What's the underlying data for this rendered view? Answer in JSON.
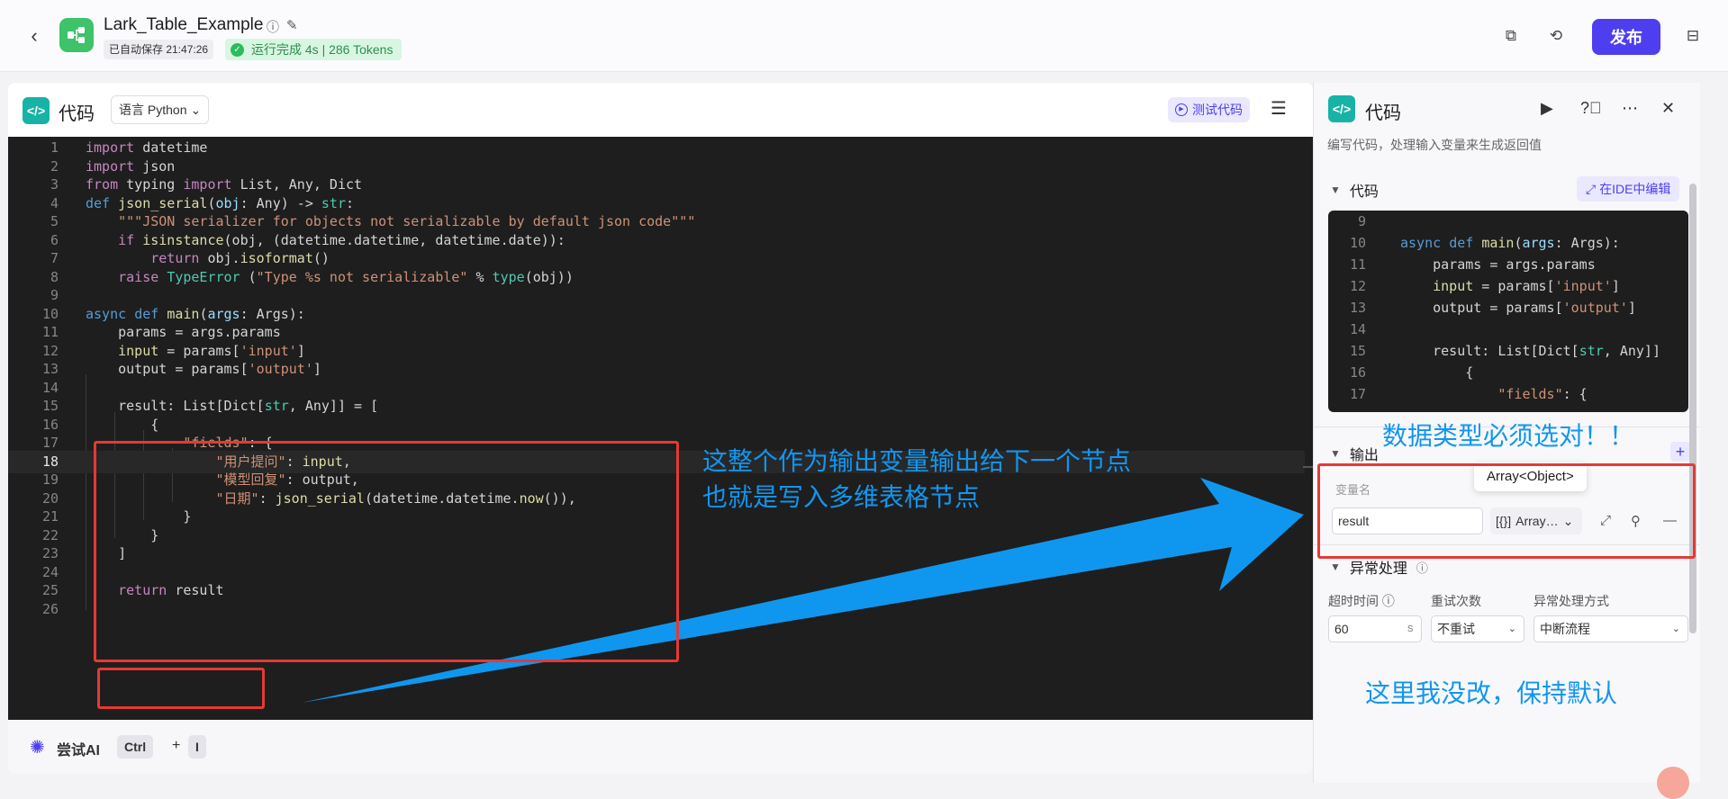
{
  "topbar": {
    "app_title": "Lark_Table_Example",
    "autosave": "已自动保存 21:47:26",
    "run_status": "运行完成 4s | 286 Tokens",
    "publish_label": "发布"
  },
  "editor": {
    "title": "代码",
    "language_select": "语言 Python",
    "test_button": "测试代码",
    "code_lines": [
      "import datetime",
      "import json",
      "from typing import List, Any, Dict",
      "def json_serial(obj: Any) -> str:",
      "    \"\"\"JSON serializer for objects not serializable by default json code\"\"\"",
      "    if isinstance(obj, (datetime.datetime, datetime.date)):",
      "        return obj.isoformat()",
      "    raise TypeError (\"Type %s not serializable\" % type(obj))",
      "",
      "async def main(args: Args):",
      "    params = args.params",
      "    input = params['input']",
      "    output = params['output']",
      "",
      "    result: List[Dict[str, Any]] = [",
      "        {",
      "            \"fields\": {",
      "                \"用户提问\": input,",
      "                \"模型回复\": output,",
      "                \"日期\": json_serial(datetime.datetime.now()),",
      "            }",
      "        }",
      "    ]",
      "",
      "    return result",
      ""
    ],
    "line_numbers": [
      "1",
      "2",
      "3",
      "4",
      "5",
      "6",
      "7",
      "8",
      "9",
      "10",
      "11",
      "12",
      "13",
      "14",
      "15",
      "16",
      "17",
      "18",
      "19",
      "20",
      "21",
      "22",
      "23",
      "24",
      "25",
      "26"
    ],
    "active_line": "18",
    "footer": {
      "try_ai": "尝试AI",
      "key1": "Ctrl",
      "plus": "+",
      "key2": "I"
    }
  },
  "right_panel": {
    "title": "代码",
    "description": "编写代码，处理输入变量来生成返回值",
    "code_section": "代码",
    "ide_button": "在IDE中编辑",
    "mini_code_lines": [
      {
        "n": "9",
        "t": ""
      },
      {
        "n": "10",
        "t": "async def main(args: Args):"
      },
      {
        "n": "11",
        "t": "    params = args.params"
      },
      {
        "n": "12",
        "t": "    input = params['input']"
      },
      {
        "n": "13",
        "t": "    output = params['output']"
      },
      {
        "n": "14",
        "t": ""
      },
      {
        "n": "15",
        "t": "    result: List[Dict[str, Any]]"
      },
      {
        "n": "16",
        "t": "        {"
      },
      {
        "n": "17",
        "t": "            \"fields\": {"
      }
    ],
    "output_section": "输出",
    "var_name_label": "变量名",
    "var_name_value": "result",
    "type_value": "Array…",
    "type_tooltip": "Array<Object>",
    "exception_section": "异常处理",
    "timeout_label": "超时时间",
    "retry_label": "重试次数",
    "handle_label": "异常处理方式",
    "timeout_value": "60",
    "timeout_unit": "s",
    "retry_value": "不重试",
    "handle_value": "中断流程"
  },
  "annotations": {
    "main_note_line1": "这整个作为输出变量输出给下一个节点",
    "main_note_line2": "也就是写入多维表格节点",
    "type_note": "数据类型必须选对！！",
    "default_note": "这里我没改，保持默认"
  },
  "colors": {
    "accent": "#4d3ef0",
    "annotation_blue": "#1196ef",
    "annotation_red": "#e53935",
    "status_green": "#2dbb5d",
    "code_bg": "#1e1e1e"
  }
}
